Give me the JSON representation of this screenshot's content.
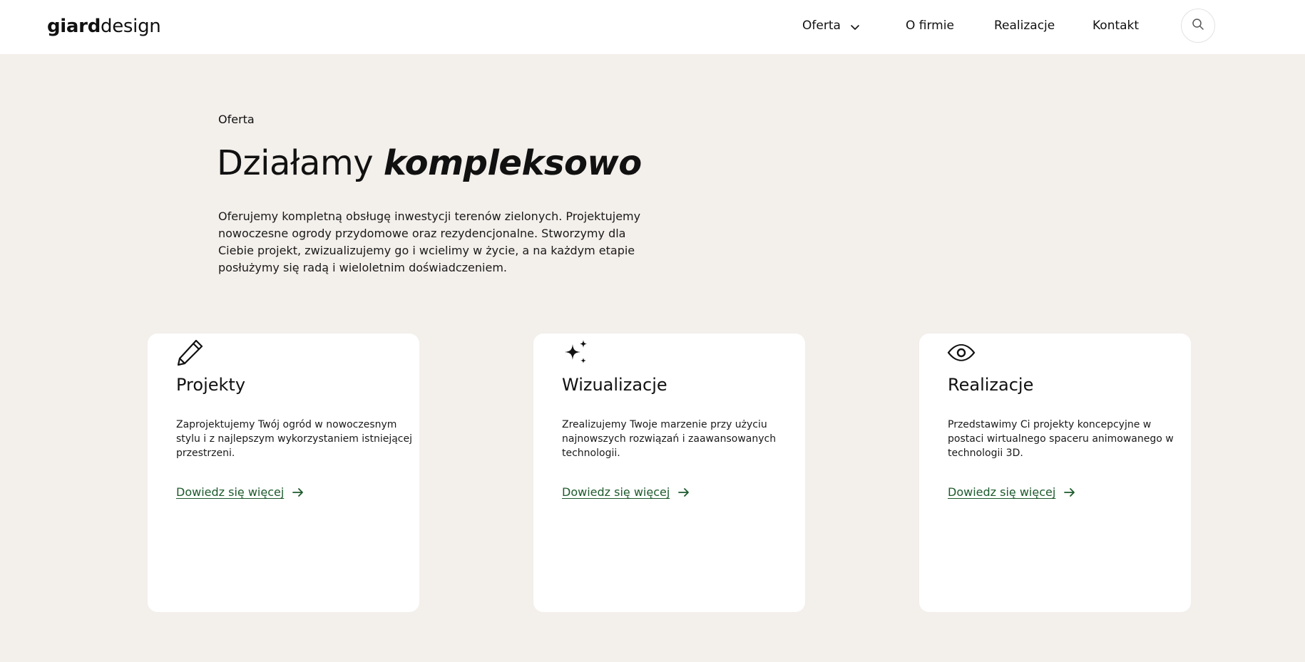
{
  "header": {
    "logo_bold": "giard",
    "logo_light": "design",
    "nav": {
      "oferta": "Oferta",
      "o_firmie": "O firmie",
      "realizacje": "Realizacje",
      "kontakt": "Kontakt"
    },
    "search_icon": "search-icon"
  },
  "hero": {
    "eyebrow": "Oferta",
    "title_regular": "Działamy",
    "title_emphasis": "kompleksowo",
    "description": "Oferujemy kompletną obsługę inwestycji terenów zielonych. Projektujemy nowoczesne ogrody przydomowe oraz rezydencjonalne. Stworzymy dla Ciebie projekt, zwizualizujemy go i wcielimy w życie, a na każdym etapie posłużymy się radą i wieloletnim doświadczeniem."
  },
  "cards": [
    {
      "icon": "pencil-icon",
      "title": "Projekty",
      "text": "Zaprojektujemy Twój ogród w nowoczesnym stylu i z najlepszym wykorzystaniem istniejącej przestrzeni.",
      "link": "Dowiedz się więcej"
    },
    {
      "icon": "sparkles-icon",
      "title": "Wizualizacje",
      "text": "Zrealizujemy Twoje marzenie przy użyciu najnowszych rozwiązań i zaawansowanych technologii.",
      "link": "Dowiedz się więcej"
    },
    {
      "icon": "eye-icon",
      "title": "Realizacje",
      "text": "Przedstawimy Ci projekty koncepcyjne w postaci wirtualnego spaceru animowanego w technologii 3D.",
      "link": "Dowiedz się więcej"
    }
  ],
  "colors": {
    "page_background": "#f3efeb",
    "card_background": "#ffffff",
    "link_green": "#1d5a2c",
    "text": "#111111"
  }
}
